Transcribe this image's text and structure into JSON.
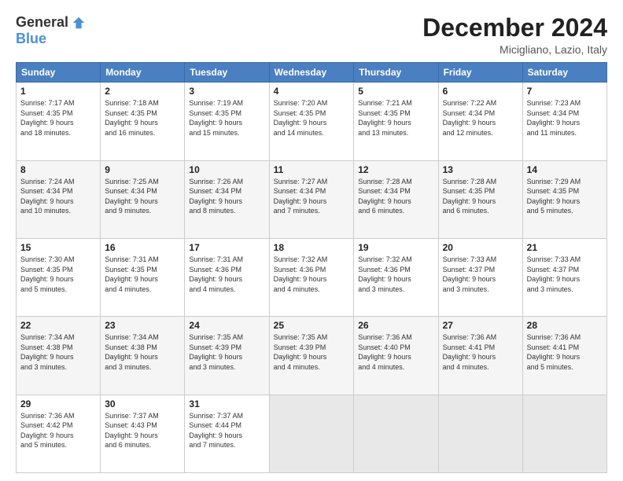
{
  "logo": {
    "general": "General",
    "blue": "Blue"
  },
  "title": "December 2024",
  "location": "Micigliano, Lazio, Italy",
  "days_of_week": [
    "Sunday",
    "Monday",
    "Tuesday",
    "Wednesday",
    "Thursday",
    "Friday",
    "Saturday"
  ],
  "weeks": [
    [
      {
        "day": "1",
        "info": "Sunrise: 7:17 AM\nSunset: 4:35 PM\nDaylight: 9 hours\nand 18 minutes."
      },
      {
        "day": "2",
        "info": "Sunrise: 7:18 AM\nSunset: 4:35 PM\nDaylight: 9 hours\nand 16 minutes."
      },
      {
        "day": "3",
        "info": "Sunrise: 7:19 AM\nSunset: 4:35 PM\nDaylight: 9 hours\nand 15 minutes."
      },
      {
        "day": "4",
        "info": "Sunrise: 7:20 AM\nSunset: 4:35 PM\nDaylight: 9 hours\nand 14 minutes."
      },
      {
        "day": "5",
        "info": "Sunrise: 7:21 AM\nSunset: 4:35 PM\nDaylight: 9 hours\nand 13 minutes."
      },
      {
        "day": "6",
        "info": "Sunrise: 7:22 AM\nSunset: 4:34 PM\nDaylight: 9 hours\nand 12 minutes."
      },
      {
        "day": "7",
        "info": "Sunrise: 7:23 AM\nSunset: 4:34 PM\nDaylight: 9 hours\nand 11 minutes."
      }
    ],
    [
      {
        "day": "8",
        "info": "Sunrise: 7:24 AM\nSunset: 4:34 PM\nDaylight: 9 hours\nand 10 minutes."
      },
      {
        "day": "9",
        "info": "Sunrise: 7:25 AM\nSunset: 4:34 PM\nDaylight: 9 hours\nand 9 minutes."
      },
      {
        "day": "10",
        "info": "Sunrise: 7:26 AM\nSunset: 4:34 PM\nDaylight: 9 hours\nand 8 minutes."
      },
      {
        "day": "11",
        "info": "Sunrise: 7:27 AM\nSunset: 4:34 PM\nDaylight: 9 hours\nand 7 minutes."
      },
      {
        "day": "12",
        "info": "Sunrise: 7:28 AM\nSunset: 4:34 PM\nDaylight: 9 hours\nand 6 minutes."
      },
      {
        "day": "13",
        "info": "Sunrise: 7:28 AM\nSunset: 4:35 PM\nDaylight: 9 hours\nand 6 minutes."
      },
      {
        "day": "14",
        "info": "Sunrise: 7:29 AM\nSunset: 4:35 PM\nDaylight: 9 hours\nand 5 minutes."
      }
    ],
    [
      {
        "day": "15",
        "info": "Sunrise: 7:30 AM\nSunset: 4:35 PM\nDaylight: 9 hours\nand 5 minutes."
      },
      {
        "day": "16",
        "info": "Sunrise: 7:31 AM\nSunset: 4:35 PM\nDaylight: 9 hours\nand 4 minutes."
      },
      {
        "day": "17",
        "info": "Sunrise: 7:31 AM\nSunset: 4:36 PM\nDaylight: 9 hours\nand 4 minutes."
      },
      {
        "day": "18",
        "info": "Sunrise: 7:32 AM\nSunset: 4:36 PM\nDaylight: 9 hours\nand 4 minutes."
      },
      {
        "day": "19",
        "info": "Sunrise: 7:32 AM\nSunset: 4:36 PM\nDaylight: 9 hours\nand 3 minutes."
      },
      {
        "day": "20",
        "info": "Sunrise: 7:33 AM\nSunset: 4:37 PM\nDaylight: 9 hours\nand 3 minutes."
      },
      {
        "day": "21",
        "info": "Sunrise: 7:33 AM\nSunset: 4:37 PM\nDaylight: 9 hours\nand 3 minutes."
      }
    ],
    [
      {
        "day": "22",
        "info": "Sunrise: 7:34 AM\nSunset: 4:38 PM\nDaylight: 9 hours\nand 3 minutes."
      },
      {
        "day": "23",
        "info": "Sunrise: 7:34 AM\nSunset: 4:38 PM\nDaylight: 9 hours\nand 3 minutes."
      },
      {
        "day": "24",
        "info": "Sunrise: 7:35 AM\nSunset: 4:39 PM\nDaylight: 9 hours\nand 3 minutes."
      },
      {
        "day": "25",
        "info": "Sunrise: 7:35 AM\nSunset: 4:39 PM\nDaylight: 9 hours\nand 4 minutes."
      },
      {
        "day": "26",
        "info": "Sunrise: 7:36 AM\nSunset: 4:40 PM\nDaylight: 9 hours\nand 4 minutes."
      },
      {
        "day": "27",
        "info": "Sunrise: 7:36 AM\nSunset: 4:41 PM\nDaylight: 9 hours\nand 4 minutes."
      },
      {
        "day": "28",
        "info": "Sunrise: 7:36 AM\nSunset: 4:41 PM\nDaylight: 9 hours\nand 5 minutes."
      }
    ],
    [
      {
        "day": "29",
        "info": "Sunrise: 7:36 AM\nSunset: 4:42 PM\nDaylight: 9 hours\nand 5 minutes."
      },
      {
        "day": "30",
        "info": "Sunrise: 7:37 AM\nSunset: 4:43 PM\nDaylight: 9 hours\nand 6 minutes."
      },
      {
        "day": "31",
        "info": "Sunrise: 7:37 AM\nSunset: 4:44 PM\nDaylight: 9 hours\nand 7 minutes."
      },
      {
        "day": "",
        "info": ""
      },
      {
        "day": "",
        "info": ""
      },
      {
        "day": "",
        "info": ""
      },
      {
        "day": "",
        "info": ""
      }
    ]
  ]
}
